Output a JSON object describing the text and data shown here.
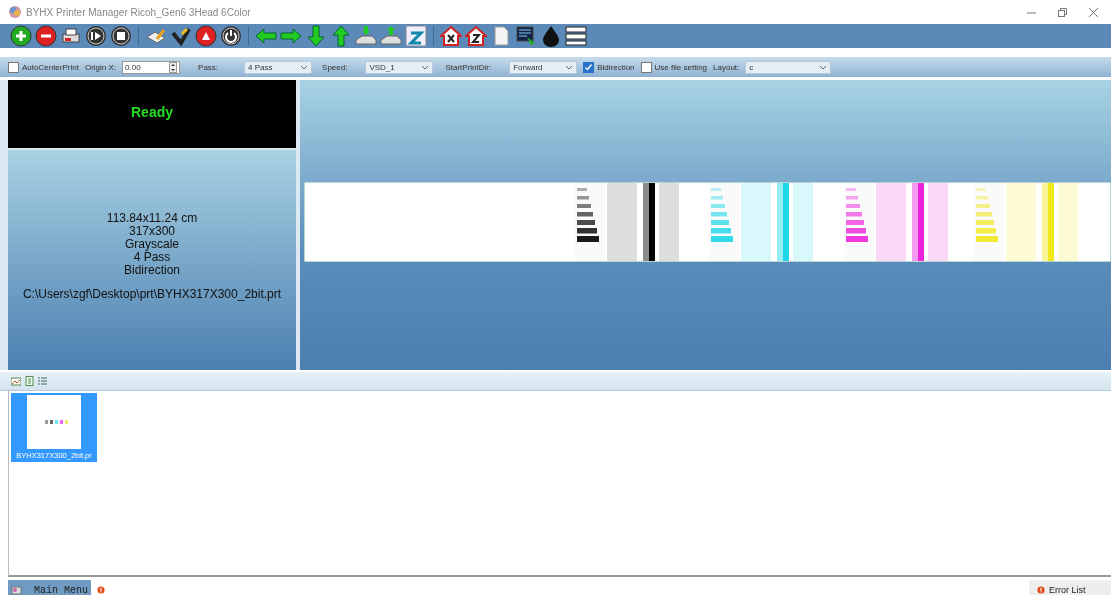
{
  "window": {
    "title": "BYHX  Printer Manager Ricoh_Gen6 3Head 6Color"
  },
  "options": {
    "auto_center_print": {
      "label": "AutoCenterPrint",
      "checked": false
    },
    "origin_x": {
      "label": "Origin X:",
      "value": "0.00"
    },
    "pass": {
      "label": "Pass:",
      "value": "4 Pass"
    },
    "speed": {
      "label": "Speed:",
      "value": "VSD_1"
    },
    "start_print_dir": {
      "label": "StartPrintDir:",
      "value": "Forward"
    },
    "bidirection": {
      "label": "Bidirection",
      "checked": true
    },
    "use_file_setting": {
      "label": "Use file setting",
      "checked": false
    },
    "layout": {
      "label": "Layout:",
      "value": "c"
    }
  },
  "status": {
    "text": "Ready"
  },
  "job_info": {
    "lines": [
      "113.84x11.24 cm",
      "317x300",
      "Grayscale",
      "4 Pass",
      "Bidirection"
    ],
    "path": "C:\\Users\\zgf\\Desktop\\prt\\BYHX317X300_2bit.prt"
  },
  "thumbnails": [
    {
      "label": "BYHX317X300_2bit.pr",
      "selected": true
    }
  ],
  "bottom_tabs": [
    {
      "label": "Main Menu",
      "selected": true
    }
  ],
  "error_list": {
    "label": "Error List"
  }
}
